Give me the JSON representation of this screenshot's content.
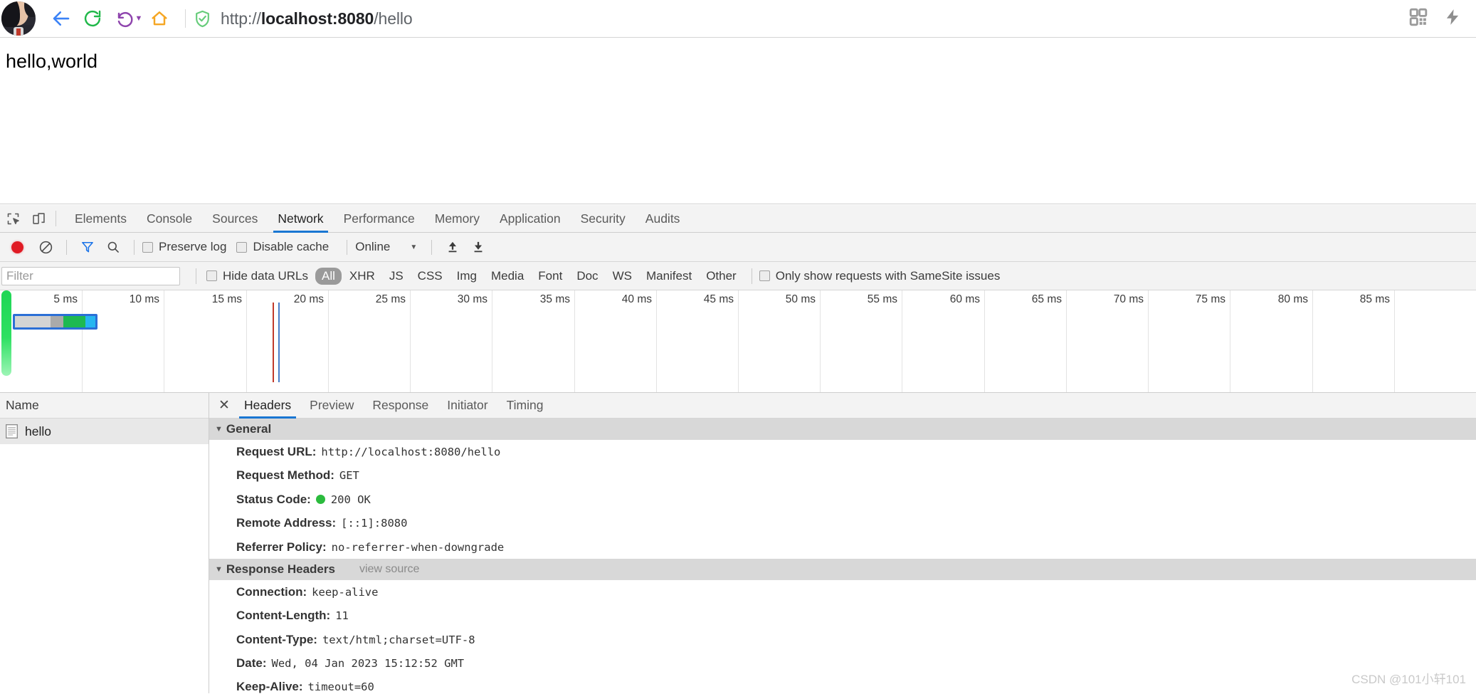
{
  "browser": {
    "url_scheme": "http://",
    "url_host": "localhost:8080",
    "url_path": "/hello",
    "back_icon": "back-arrow-icon",
    "reload_icon": "reload-icon",
    "history_icon": "history-back-icon",
    "home_icon": "home-icon",
    "shield_icon": "security-shield-icon",
    "qr_icon": "qr-code-icon",
    "bolt_icon": "lightning-bolt-icon",
    "avatar": "user-avatar"
  },
  "page": {
    "body_text": "hello,world"
  },
  "devtools": {
    "inspect_icon": "inspect-element-icon",
    "device_icon": "device-toolbar-icon",
    "tabs": [
      {
        "label": "Elements",
        "active": false
      },
      {
        "label": "Console",
        "active": false
      },
      {
        "label": "Sources",
        "active": false
      },
      {
        "label": "Network",
        "active": true
      },
      {
        "label": "Performance",
        "active": false
      },
      {
        "label": "Memory",
        "active": false
      },
      {
        "label": "Application",
        "active": false
      },
      {
        "label": "Security",
        "active": false
      },
      {
        "label": "Audits",
        "active": false
      }
    ],
    "controls": {
      "record_icon": "record-button-icon",
      "clear_icon": "clear-network-log-icon",
      "filter_icon": "filter-funnel-icon",
      "search_icon": "search-magnifier-icon",
      "preserve_log_label": "Preserve log",
      "preserve_log_checked": false,
      "disable_cache_label": "Disable cache",
      "disable_cache_checked": false,
      "throttle_value": "Online",
      "throttle_caret": "▼",
      "import_icon": "import-har-icon",
      "export_icon": "export-har-icon"
    },
    "filter": {
      "placeholder": "Filter",
      "value": "",
      "hide_data_urls_label": "Hide data URLs",
      "hide_data_urls_checked": false,
      "types": [
        "All",
        "XHR",
        "JS",
        "CSS",
        "Img",
        "Media",
        "Font",
        "Doc",
        "WS",
        "Manifest",
        "Other"
      ],
      "active_type": "All",
      "samesite_label": "Only show requests with SameSite issues",
      "samesite_checked": false
    },
    "overview": {
      "tick_labels": [
        "5 ms",
        "10 ms",
        "15 ms",
        "20 ms",
        "25 ms",
        "30 ms",
        "35 ms",
        "40 ms",
        "45 ms",
        "50 ms",
        "55 ms",
        "60 ms",
        "65 ms",
        "70 ms",
        "75 ms",
        "80 ms",
        "85 ms"
      ],
      "waterfall_segments": [
        {
          "name": "queueing",
          "color": "#d4d4d4",
          "width_pct": 44
        },
        {
          "name": "stalled",
          "color": "#aaaaaa",
          "width_pct": 16
        },
        {
          "name": "waiting-ttfb",
          "color": "#1eb951",
          "width_pct": 28
        },
        {
          "name": "content-download",
          "color": "#26b6f0",
          "width_pct": 12
        }
      ],
      "dom_content_loaded_color": "#c0392b",
      "load_event_color": "#4a7ec9"
    },
    "request_list": {
      "column_header": "Name",
      "rows": [
        {
          "name": "hello",
          "icon": "document-icon",
          "selected": true
        }
      ]
    },
    "detail": {
      "close_icon": "close-icon",
      "tabs": [
        {
          "label": "Headers",
          "active": true
        },
        {
          "label": "Preview",
          "active": false
        },
        {
          "label": "Response",
          "active": false
        },
        {
          "label": "Initiator",
          "active": false
        },
        {
          "label": "Timing",
          "active": false
        }
      ],
      "sections": [
        {
          "title": "General",
          "view_source": "",
          "rows": [
            {
              "key": "Request URL:",
              "value": "http://localhost:8080/hello",
              "status_dot": false
            },
            {
              "key": "Request Method:",
              "value": "GET",
              "status_dot": false
            },
            {
              "key": "Status Code:",
              "value": "200 OK",
              "status_dot": true,
              "status_color": "#2bbb3d"
            },
            {
              "key": "Remote Address:",
              "value": "[::1]:8080",
              "status_dot": false
            },
            {
              "key": "Referrer Policy:",
              "value": "no-referrer-when-downgrade",
              "status_dot": false
            }
          ]
        },
        {
          "title": "Response Headers",
          "view_source": "view source",
          "rows": [
            {
              "key": "Connection:",
              "value": "keep-alive",
              "status_dot": false
            },
            {
              "key": "Content-Length:",
              "value": "11",
              "status_dot": false
            },
            {
              "key": "Content-Type:",
              "value": "text/html;charset=UTF-8",
              "status_dot": false
            },
            {
              "key": "Date:",
              "value": "Wed, 04 Jan 2023 15:12:52 GMT",
              "status_dot": false
            },
            {
              "key": "Keep-Alive:",
              "value": "timeout=60",
              "status_dot": false
            }
          ]
        }
      ]
    }
  },
  "watermark": "CSDN @101小轩101"
}
